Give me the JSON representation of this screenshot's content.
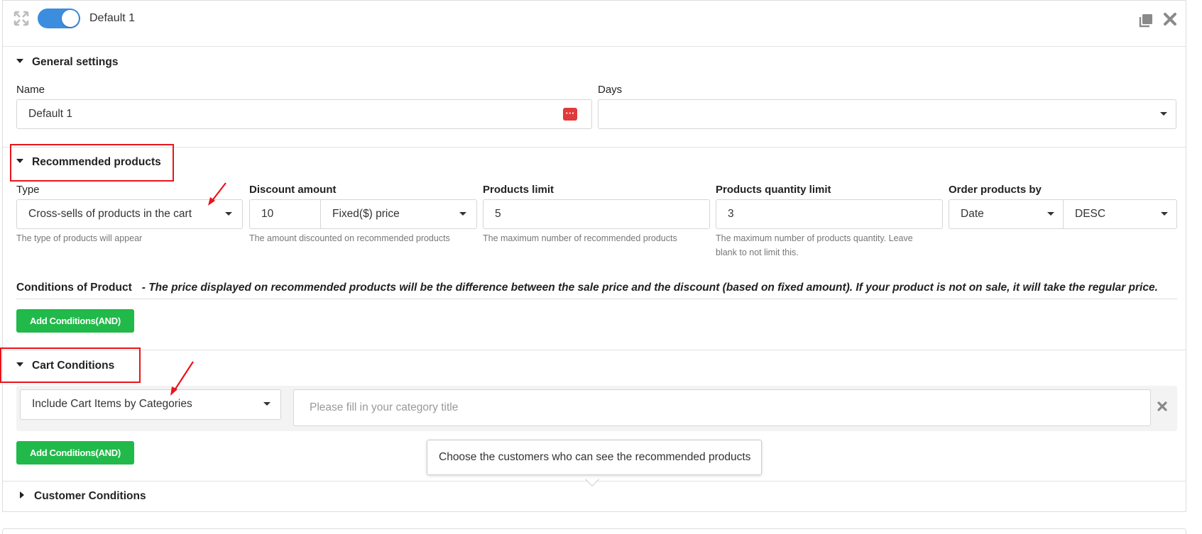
{
  "header": {
    "title": "Default 1",
    "toggle_on": true
  },
  "general": {
    "heading": "General settings",
    "name_label": "Name",
    "name_value": "Default 1",
    "days_label": "Days",
    "days_value": ""
  },
  "recommended": {
    "heading": "Recommended products",
    "type_label": "Type",
    "type_value": "Cross-sells of products in the cart",
    "type_help": "The type of products will appear",
    "discount_label": "Discount amount",
    "discount_value": "10",
    "discount_type": "Fixed($) price",
    "discount_help": "The amount discounted on recommended products",
    "limit_label": "Products limit",
    "limit_value": "5",
    "limit_help": "The maximum number of recommended products",
    "qty_label": "Products quantity limit",
    "qty_value": "3",
    "qty_help_line1": "The maximum number of products quantity. Leave",
    "qty_help_line2": "blank to not limit this.",
    "order_label": "Order products by",
    "order_by": "Date",
    "order_dir": "DESC"
  },
  "product_conditions": {
    "title": "Conditions of Product",
    "note": "- The price displayed on recommended products will be the difference between the sale price and the discount (based on fixed amount). If your product is not on sale, it will take the regular price.",
    "add_button": "Add Conditions(AND)"
  },
  "cart_conditions": {
    "heading": "Cart Conditions",
    "rule_value": "Include Cart Items by Categories",
    "category_placeholder": "Please fill in your category title",
    "add_button": "Add Conditions(AND)"
  },
  "tooltip": {
    "text": "Choose the customers who can see the recommended products"
  },
  "customer_conditions": {
    "heading": "Customer Conditions"
  },
  "colors": {
    "accent": "#3c8dde",
    "button_green": "#21b94a",
    "highlight_red": "#e8151b"
  }
}
